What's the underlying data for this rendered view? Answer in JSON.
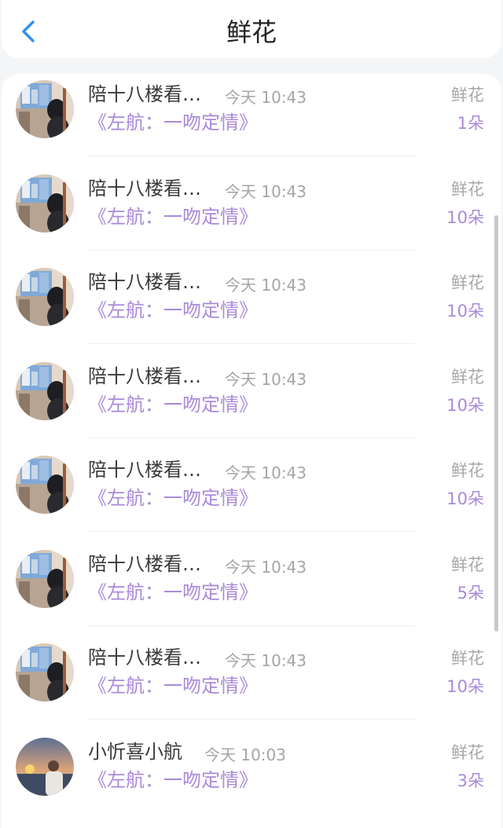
{
  "header": {
    "title": "鲜花",
    "back_icon": "chevron-left-icon",
    "accent_color": "#2f8ff5"
  },
  "records": [
    {
      "name": "陪十八楼看…",
      "time": "今天 10:43",
      "subtitle": "《左航：一吻定情》",
      "gift_type": "鲜花",
      "count": "1朵",
      "avatar": "girl-window"
    },
    {
      "name": "陪十八楼看…",
      "time": "今天 10:43",
      "subtitle": "《左航：一吻定情》",
      "gift_type": "鲜花",
      "count": "10朵",
      "avatar": "girl-window"
    },
    {
      "name": "陪十八楼看…",
      "time": "今天 10:43",
      "subtitle": "《左航：一吻定情》",
      "gift_type": "鲜花",
      "count": "10朵",
      "avatar": "girl-window"
    },
    {
      "name": "陪十八楼看…",
      "time": "今天 10:43",
      "subtitle": "《左航：一吻定情》",
      "gift_type": "鲜花",
      "count": "10朵",
      "avatar": "girl-window"
    },
    {
      "name": "陪十八楼看…",
      "time": "今天 10:43",
      "subtitle": "《左航：一吻定情》",
      "gift_type": "鲜花",
      "count": "10朵",
      "avatar": "girl-window"
    },
    {
      "name": "陪十八楼看…",
      "time": "今天 10:43",
      "subtitle": "《左航：一吻定情》",
      "gift_type": "鲜花",
      "count": "5朵",
      "avatar": "girl-window"
    },
    {
      "name": "陪十八楼看…",
      "time": "今天 10:43",
      "subtitle": "《左航：一吻定情》",
      "gift_type": "鲜花",
      "count": "10朵",
      "avatar": "girl-window"
    },
    {
      "name": "小忻喜小航",
      "time": "今天 10:03",
      "subtitle": "《左航：一吻定情》",
      "gift_type": "鲜花",
      "count": "3朵",
      "avatar": "sunset-person"
    }
  ],
  "colors": {
    "name": "#3a3a3a",
    "time": "#a5a5a5",
    "subtitle": "#a98ad9",
    "count": "#a98ad9",
    "gift_type": "#a8a8a8"
  }
}
